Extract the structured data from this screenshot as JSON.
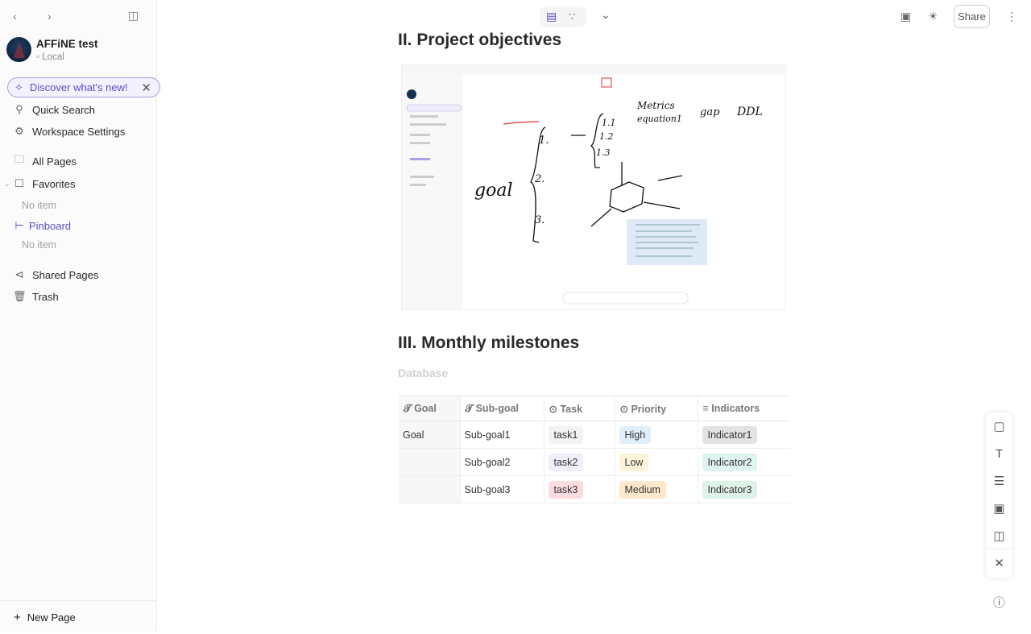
{
  "sidebar": {
    "workspace_name": "AFFiNE test",
    "workspace_type": "Local",
    "discover": "Discover what's new!",
    "items": [
      {
        "label": "Quick Search",
        "icon": "search-icon"
      },
      {
        "label": "Workspace Settings",
        "icon": "gear-icon"
      },
      {
        "label": "All Pages",
        "icon": "folder-icon"
      },
      {
        "label": "Favorites",
        "icon": "bookmark-icon"
      },
      {
        "label": "Pinboard",
        "icon": "pinboard-icon"
      },
      {
        "label": "Shared Pages",
        "icon": "share-icon"
      },
      {
        "label": "Trash",
        "icon": "trash-icon"
      }
    ],
    "no_item": "No item",
    "new_page": "New Page"
  },
  "topbar": {
    "share_label": "Share"
  },
  "doc": {
    "heading2": "II. Project objectives",
    "heading3": "III. Monthly milestones",
    "database_title": "Database",
    "sketch_words": [
      "goal",
      "1.",
      "2.",
      "3.",
      "1.1",
      "1.2",
      "1.3",
      "Metrics",
      "equation1",
      "gap",
      "DDL"
    ]
  },
  "table": {
    "columns": [
      "Goal",
      "Sub-goal",
      "Task",
      "Priority",
      "Indicators"
    ],
    "rows": [
      {
        "goal": "Goal",
        "subgoal": "Sub-goal1",
        "task": "task1",
        "priority": "High",
        "indicator": "Indicator1"
      },
      {
        "goal": "",
        "subgoal": "Sub-goal2",
        "task": "task2",
        "priority": "Low",
        "indicator": "Indicator2"
      },
      {
        "goal": "",
        "subgoal": "Sub-goal3",
        "task": "task3",
        "priority": "Medium",
        "indicator": "Indicator3"
      }
    ]
  },
  "colors": {
    "accent": "#5a4fc8",
    "high": "#e1eefc",
    "low": "#fdf4d9",
    "medium": "#fde8cc",
    "task1": "#f3f3f3",
    "task2": "#eeeefb",
    "task3": "#fbdde0",
    "ind1": "#e3e3e3",
    "ind2": "#dff4f0",
    "ind3": "#dff2e8"
  }
}
